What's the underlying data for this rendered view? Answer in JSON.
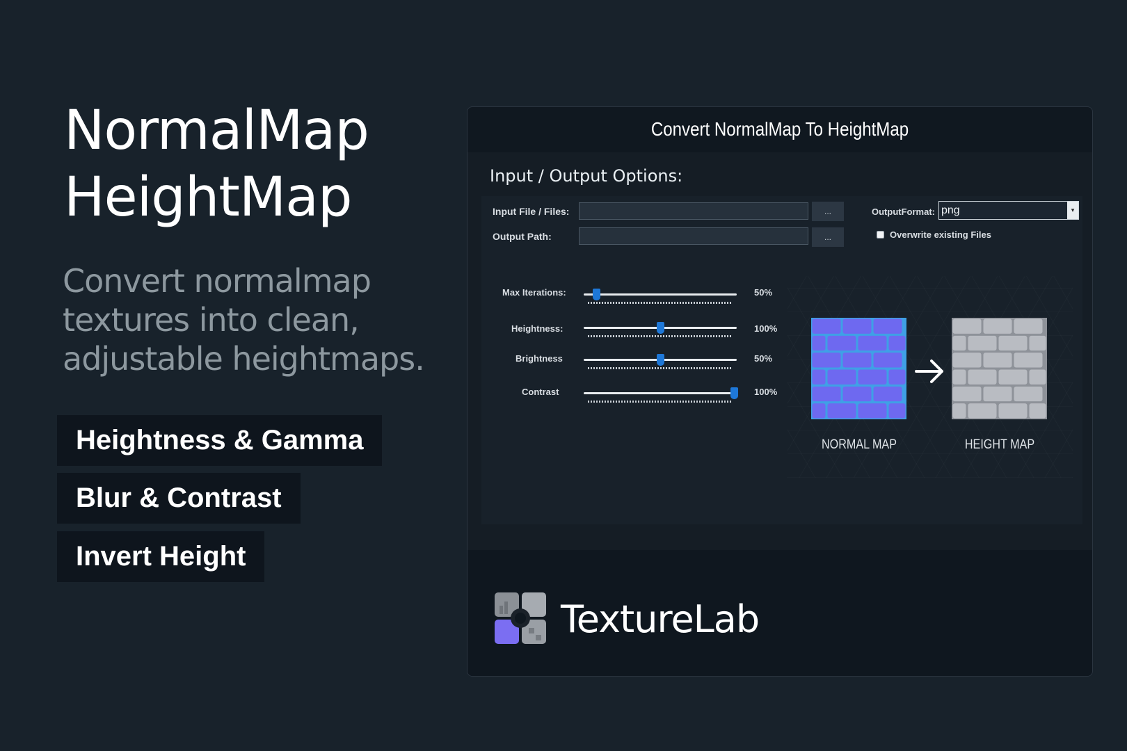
{
  "hero": {
    "headline_line1": "NormalMap",
    "headline_line2": "HeightMap",
    "subtitle_line1": "Convert normalmap",
    "subtitle_line2": "textures into clean,",
    "subtitle_line3": "adjustable heightmaps."
  },
  "features": [
    "Heightness & Gamma",
    "Blur & Contrast",
    "Invert Height"
  ],
  "window": {
    "title": "Convert NormalMap To HeightMap",
    "section_title": "Input / Output Options:",
    "input_label": "Input File / Files:",
    "input_value": "",
    "output_label": "Output Path:",
    "output_value": "",
    "browse_label": "...",
    "format_label": "OutputFormat:",
    "format_value": "png",
    "overwrite_label": "Overwrite existing Files",
    "overwrite_checked": false
  },
  "sliders": [
    {
      "label": "Max Iterations:",
      "value_text": "50%",
      "position": 0.08
    },
    {
      "label": "Heightness:",
      "value_text": "100%",
      "position": 0.5
    },
    {
      "label": "Brightness",
      "value_text": "50%",
      "position": 0.5
    },
    {
      "label": "Contrast",
      "value_text": "100%",
      "position": 0.98
    }
  ],
  "preview": {
    "normal_caption": "NORMAL MAP",
    "height_caption": "HEIGHT MAP",
    "normal_color": "#6e69f0",
    "normal_mortar": "#3fa0e6",
    "height_color": "#b9bcc2",
    "height_mortar": "#8e9299"
  },
  "brand": {
    "name": "TextureLab"
  },
  "colors": {
    "background": "#18222b",
    "accent": "#1e78d8",
    "pill_bg": "#0e151d"
  }
}
